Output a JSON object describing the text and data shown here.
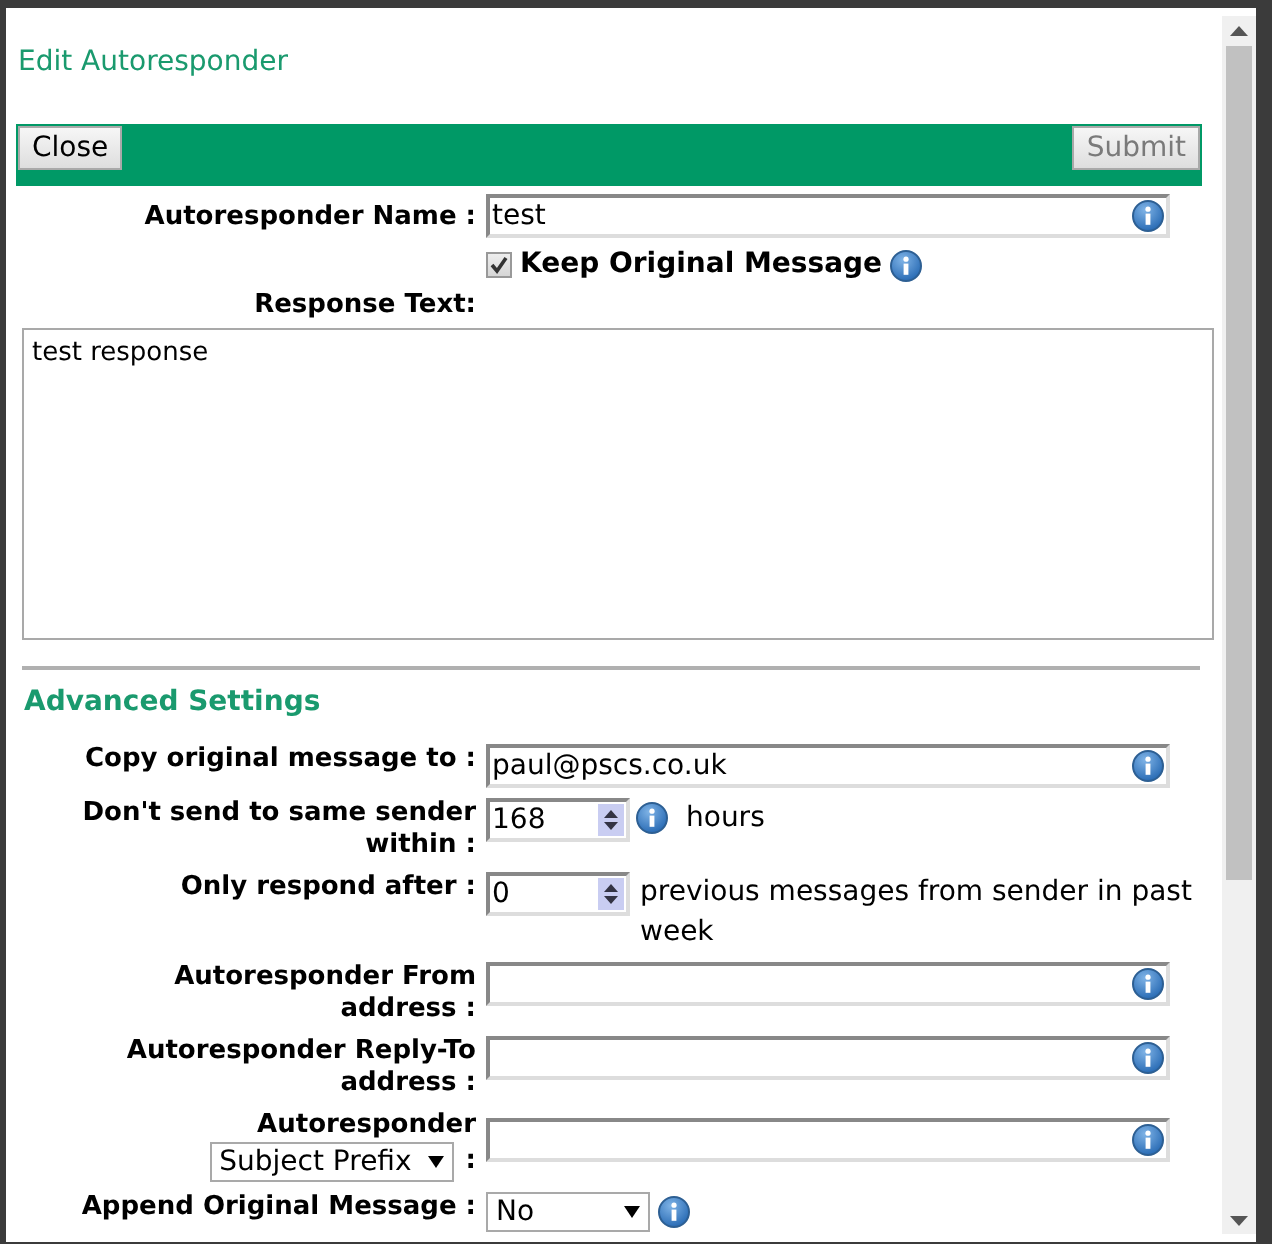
{
  "title": "Edit Autoresponder",
  "toolbar": {
    "close": {
      "label": "Close"
    },
    "submit": {
      "label": "Submit",
      "disabled": true
    }
  },
  "name_field": {
    "label": "Autoresponder Name :",
    "value": "test"
  },
  "keep_original": {
    "label": "Keep Original Message",
    "checked": true
  },
  "response": {
    "label": "Response Text:",
    "value": "test response"
  },
  "advanced": {
    "heading": "Advanced Settings",
    "rows": [
      {
        "kind": "text",
        "label": "Copy original message to :",
        "value": "paul@pscs.co.uk"
      },
      {
        "kind": "number",
        "label": "Don't send to same sender within :",
        "value": "168",
        "suffix": "hours",
        "info": true
      },
      {
        "kind": "number",
        "label": "Only respond after :",
        "value": "0",
        "suffix": "previous messages from sender in past week",
        "info": false
      },
      {
        "kind": "text",
        "label": "Autoresponder From address :"
      },
      {
        "kind": "text",
        "label": "Autoresponder Reply-To address :"
      },
      {
        "kind": "select-label",
        "label": "Autoresponder",
        "select": "Subject Prefix",
        "colon": ":"
      },
      {
        "kind": "select",
        "label": "Append Original Message :",
        "value": "No"
      }
    ]
  }
}
